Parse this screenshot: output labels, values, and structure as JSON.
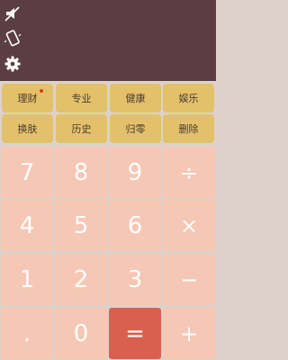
{
  "display": {
    "background": "#5b3e43",
    "icons": [
      "speaker-mute-icon",
      "phone-vibrate-icon",
      "settings-gear-icon"
    ]
  },
  "function_rows": [
    [
      {
        "label": "理财",
        "badge": true
      },
      {
        "label": "专业"
      },
      {
        "label": "健康"
      },
      {
        "label": "娱乐"
      }
    ],
    [
      {
        "label": "换肤"
      },
      {
        "label": "历史"
      },
      {
        "label": "归零"
      },
      {
        "label": "删除"
      }
    ]
  ],
  "keypad": [
    [
      "7",
      "8",
      "9",
      "÷"
    ],
    [
      "4",
      "5",
      "6",
      "×"
    ],
    [
      "1",
      "2",
      "3",
      "−"
    ],
    [
      ".",
      "0",
      "=",
      "+"
    ]
  ],
  "colors": {
    "function_button": "#e3c16a",
    "key": "#f6c7b4",
    "equals_key": "#d9604f",
    "badge": "#d93a2a"
  }
}
